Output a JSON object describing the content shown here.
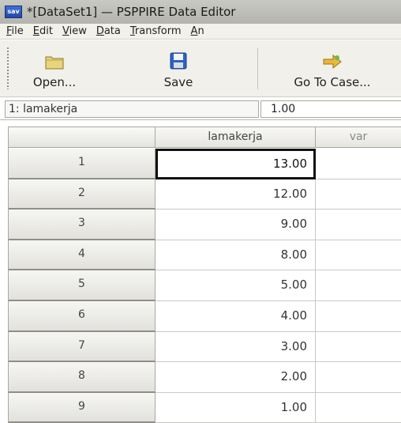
{
  "window": {
    "title": "*[DataSet1] — PSPPIRE Data Editor",
    "app_icon_text": "sav"
  },
  "menubar": {
    "items": [
      {
        "mnemonic": "F",
        "rest": "ile"
      },
      {
        "mnemonic": "E",
        "rest": "dit"
      },
      {
        "mnemonic": "V",
        "rest": "iew"
      },
      {
        "mnemonic": "D",
        "rest": "ata"
      },
      {
        "mnemonic": "T",
        "rest": "ransform"
      },
      {
        "mnemonic": "A",
        "rest": "n"
      }
    ]
  },
  "toolbar": {
    "open_label": "Open...",
    "save_label": "Save",
    "goto_label": "Go To Case..."
  },
  "cell_ref": {
    "reference": "1: lamakerja",
    "value": "1.00"
  },
  "grid": {
    "columns": [
      "lamakerja",
      "var"
    ],
    "rows": [
      {
        "num": "1",
        "value": "13.00"
      },
      {
        "num": "2",
        "value": "12.00"
      },
      {
        "num": "3",
        "value": "9.00"
      },
      {
        "num": "4",
        "value": "8.00"
      },
      {
        "num": "5",
        "value": "5.00"
      },
      {
        "num": "6",
        "value": "4.00"
      },
      {
        "num": "7",
        "value": "3.00"
      },
      {
        "num": "8",
        "value": "2.00"
      },
      {
        "num": "9",
        "value": "1.00"
      }
    ]
  },
  "colors": {
    "active_cell_border": "#111111",
    "header_bg": "#e6e5e0"
  }
}
